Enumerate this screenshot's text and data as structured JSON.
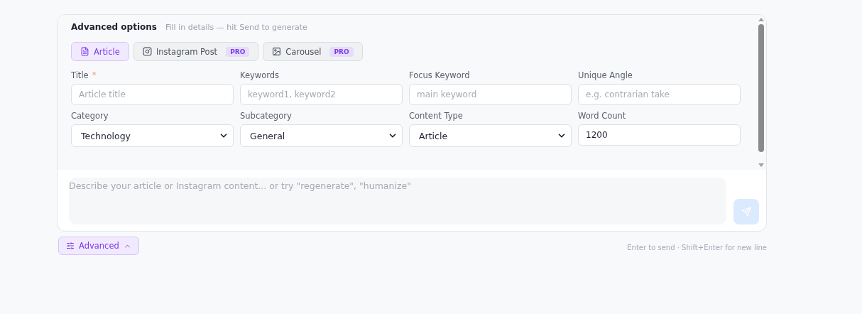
{
  "advanced_panel": {
    "title": "Advanced options",
    "hint": "Fill in details — hit Send to generate",
    "tabs": [
      {
        "label": "Article",
        "selected": true
      },
      {
        "label": "Instagram Post",
        "badge": "PRO",
        "selected": false
      },
      {
        "label": "Carousel",
        "badge": "PRO",
        "selected": false
      }
    ],
    "fields": [
      {
        "label": "Title",
        "required_mark": "*",
        "kind": "input",
        "placeholder": "Article title"
      },
      {
        "label": "Keywords",
        "kind": "input",
        "placeholder": "keyword1, keyword2"
      },
      {
        "label": "Focus Keyword",
        "kind": "input",
        "placeholder": "main keyword"
      },
      {
        "label": "Unique Angle",
        "kind": "input",
        "placeholder": "e.g. contrarian take"
      },
      {
        "label": "Category",
        "kind": "select",
        "value": "Technology"
      },
      {
        "label": "Subcategory",
        "kind": "select",
        "value": "General"
      },
      {
        "label": "Content Type",
        "kind": "select",
        "value": "Article"
      },
      {
        "label": "Word Count",
        "kind": "input",
        "value": "1200"
      }
    ]
  },
  "composer": {
    "placeholder": "Describe your article or Instagram content... or try \"regenerate\", \"humanize\"",
    "send_disabled": true
  },
  "advanced_toggle": {
    "label": "Advanced",
    "expanded": true
  },
  "footer_hint": "Enter to send · Shift+Enter for new line"
}
